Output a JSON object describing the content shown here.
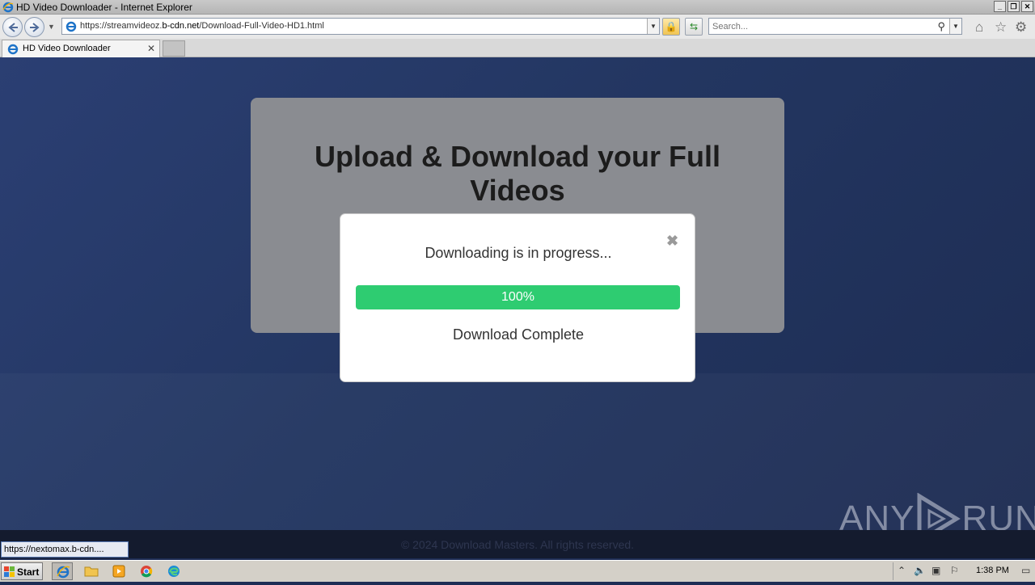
{
  "window": {
    "title": "HD Video Downloader - Internet Explorer",
    "controls": [
      "minimize",
      "restore",
      "close"
    ]
  },
  "navbar": {
    "url_prefix": "https://streamvideoz.",
    "url_domain": "b-cdn.net",
    "url_path": "/Download-Full-Video-HD1.html",
    "search_placeholder": "Search..."
  },
  "tabs": [
    {
      "label": "HD Video Downloader",
      "active": true
    }
  ],
  "page": {
    "heading": "Upload & Download your Full Videos",
    "footer": "© 2024 Download Masters. All rights reserved."
  },
  "modal": {
    "message": "Downloading is in progress...",
    "progress_label": "100%",
    "progress_value": 1.0,
    "complete_text": "Download Complete",
    "close_glyph": "✖"
  },
  "status_url": "https://nextomax.b-cdn....",
  "watermark": {
    "left": "ANY",
    "right": "RUN"
  },
  "taskbar": {
    "start_label": "Start",
    "apps": [
      "internet-explorer",
      "file-explorer",
      "media-player",
      "chrome",
      "edge"
    ],
    "clock": "1:38 PM"
  },
  "colors": {
    "progress_fill": "#2ecc71",
    "page_bg": "#233661",
    "card_bg": "#8a8c91"
  }
}
